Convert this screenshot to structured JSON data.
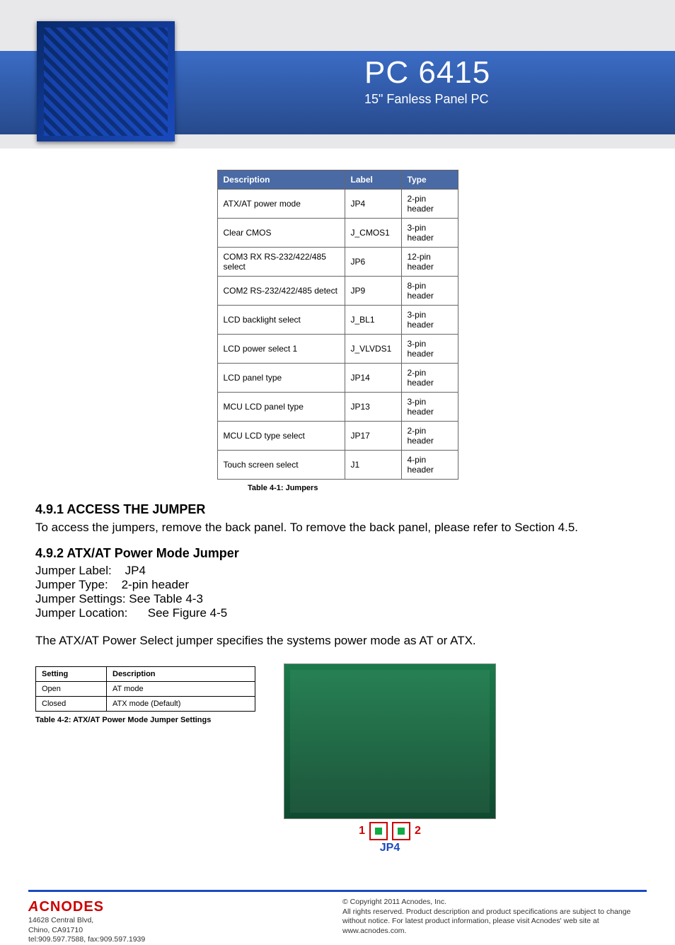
{
  "header": {
    "product": "PC 6415",
    "subtitle": "15\" Fanless Panel PC"
  },
  "jumper_table": {
    "headers": [
      "Description",
      "Label",
      "Type"
    ],
    "rows": [
      [
        "ATX/AT power mode",
        "JP4",
        "2-pin header"
      ],
      [
        "Clear CMOS",
        "J_CMOS1",
        "3-pin header"
      ],
      [
        "COM3 RX RS-232/422/485 select",
        "JP6",
        "12-pin header"
      ],
      [
        "COM2 RS-232/422/485 detect",
        "JP9",
        "8-pin header"
      ],
      [
        "LCD backlight select",
        "J_BL1",
        "3-pin header"
      ],
      [
        "LCD power select 1",
        "J_VLVDS1",
        "3-pin header"
      ],
      [
        "LCD panel type",
        "JP14",
        "2-pin header"
      ],
      [
        "MCU LCD panel type",
        "JP13",
        "3-pin header"
      ],
      [
        "MCU LCD type select",
        "JP17",
        "2-pin header"
      ],
      [
        "Touch screen select",
        "J1",
        "4-pin header"
      ]
    ],
    "caption": "Table 4-1: Jumpers"
  },
  "section_491": {
    "heading": "4.9.1 ACCESS THE JUMPER",
    "body": "To access the jumpers, remove the back panel. To remove the back panel, please refer to Section 4.5."
  },
  "section_492": {
    "heading": "4.9.2 ATX/AT Power Mode Jumper",
    "specs": {
      "label_k": "Jumper Label:",
      "label_v": "JP4",
      "type_k": "Jumper Type:",
      "type_v": "2-pin header",
      "settings_k": "Jumper Settings:",
      "settings_v": "See Table 4-3",
      "location_k": "Jumper Location:",
      "location_v": "See Figure 4-5"
    },
    "body": "The ATX/AT Power Select jumper specifies the systems power mode as AT or ATX.",
    "settings_table": {
      "headers": [
        "Setting",
        "Description"
      ],
      "rows": [
        [
          "Open",
          "AT mode"
        ],
        [
          "Closed",
          "ATX mode (Default)"
        ]
      ],
      "caption": "Table 4-2: ATX/AT Power Mode Jumper Settings"
    },
    "callout": {
      "left_num": "1",
      "right_num": "2",
      "label": "JP4"
    }
  },
  "footer": {
    "brand": "CNODES",
    "address1": "14628 Central Blvd,",
    "address2": "Chino, CA91710",
    "phone": "tel:909.597.7588, fax:909.597.1939",
    "copy1": "© Copyright 2011 Acnodes, Inc.",
    "copy2": "All rights reserved. Product description and product specifications are subject to change without notice. For latest product information, please visit Acnodes' web site at www.acnodes.com."
  }
}
